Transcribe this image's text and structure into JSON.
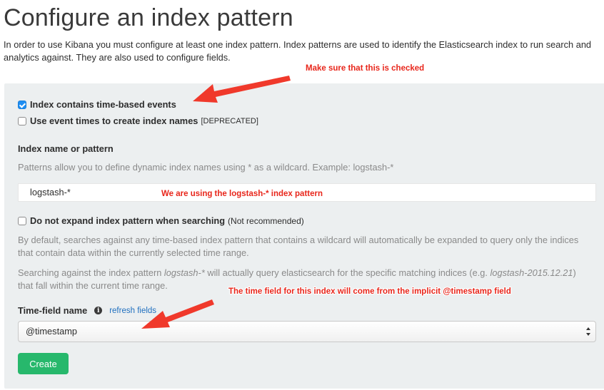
{
  "page": {
    "title": "Configure an index pattern",
    "intro_line1": "In order to use Kibana you must configure at least one index pattern. Index patterns are used to identify the Elasticsearch index to run search and",
    "intro_line2": "analytics against. They are also used to configure fields."
  },
  "form": {
    "time_based": {
      "label": "Index contains time-based events",
      "checked": true
    },
    "event_times": {
      "label": "Use event times to create index names",
      "note": "[DEPRECATED]",
      "checked": false
    },
    "index_name": {
      "label": "Index name or pattern",
      "help": "Patterns allow you to define dynamic index names using * as a wildcard. Example: logstash-*",
      "value": "logstash-*"
    },
    "no_expand": {
      "label": "Do not expand index pattern when searching",
      "note": "(Not recommended)",
      "checked": false,
      "help1_line1": "By default, searches against any time-based index pattern that contains a wildcard will automatically be expanded to query only the indices",
      "help1_line2": "that contain data within the currently selected time range.",
      "help2_pre": "Searching against the index pattern ",
      "help2_em1": "logstash-*",
      "help2_mid": " will actually query elasticsearch for the specific matching indices (e.g. ",
      "help2_em2": "logstash-2015.12.21",
      "help2_post": ")",
      "help2_line2": "that fall within the current time range."
    },
    "time_field": {
      "label": "Time-field name",
      "info_icon": "i",
      "refresh_label": "refresh fields",
      "selected": "@timestamp"
    },
    "create_label": "Create"
  },
  "annotations": {
    "note1": "Make sure that this is checked",
    "note2": "We are using the logstash-* index pattern",
    "note3": "The time field for this index will come from the implicit @timestamp field",
    "color": "#e8261b"
  },
  "colors": {
    "panel_bg": "#eceff0",
    "checkbox_checked": "#1e8ef3",
    "create_button": "#27b86c",
    "link": "#1f6fbf"
  }
}
